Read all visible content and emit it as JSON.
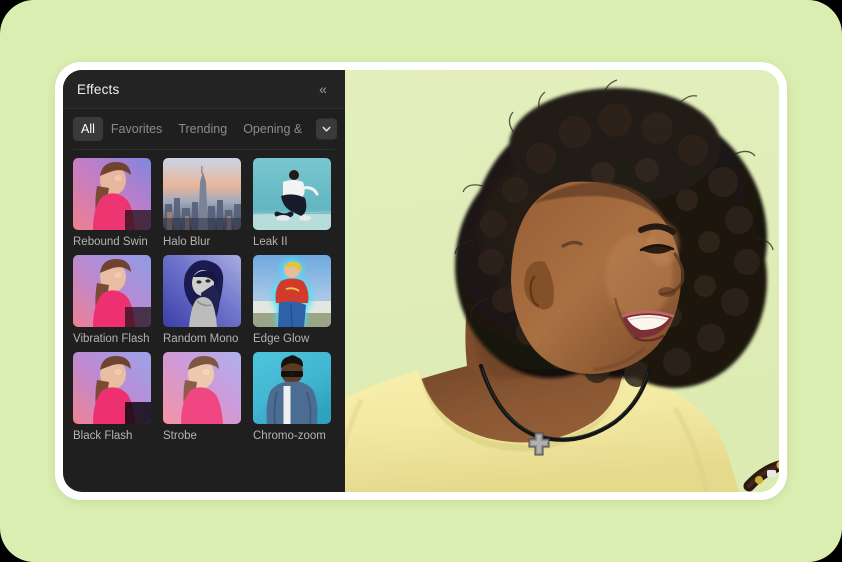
{
  "theme": {
    "page_background": "#d9eeb0",
    "frame_color": "#ffffff",
    "panel_background": "#1f1f1f",
    "panel_header_background": "#242424",
    "accent_chip_background": "#3a3a3a",
    "label_color": "#b4b4b4",
    "title_color": "#f0f0f0"
  },
  "panel": {
    "title": "Effects",
    "collapse_icon": "double-chevron-left-icon",
    "collapse_glyph": "«"
  },
  "tabs": {
    "items": [
      {
        "label": "All",
        "active": true
      },
      {
        "label": "Favorites",
        "active": false
      },
      {
        "label": "Trending",
        "active": false
      },
      {
        "label": "Opening &",
        "active": false
      }
    ],
    "more_button": {
      "icon": "chevron-down-icon",
      "label": ""
    }
  },
  "effects": {
    "items": [
      {
        "label": "Rebound Swin",
        "thumb": "pink-purple-portrait"
      },
      {
        "label": "Halo Blur",
        "thumb": "city-skyline-sunset"
      },
      {
        "label": "Leak II",
        "thumb": "teal-dancer"
      },
      {
        "label": "Vibration Flash",
        "thumb": "pink-blue-portrait"
      },
      {
        "label": "Random Mono",
        "thumb": "mono-blue-portrait"
      },
      {
        "label": "Edge Glow",
        "thumb": "glow-outline-person"
      },
      {
        "label": "Black Flash",
        "thumb": "pink-purple-portrait-2"
      },
      {
        "label": "Strobe",
        "thumb": "pink-portrait-strobe"
      },
      {
        "label": "Chromo-zoom",
        "thumb": "cyan-portrait-sunglasses"
      }
    ]
  },
  "preview": {
    "subject": "smiling-woman-portrait",
    "background_color": "#e2eebb",
    "garment_color": "#f4eca8",
    "accessory": "black-cord-cross-necklace"
  }
}
